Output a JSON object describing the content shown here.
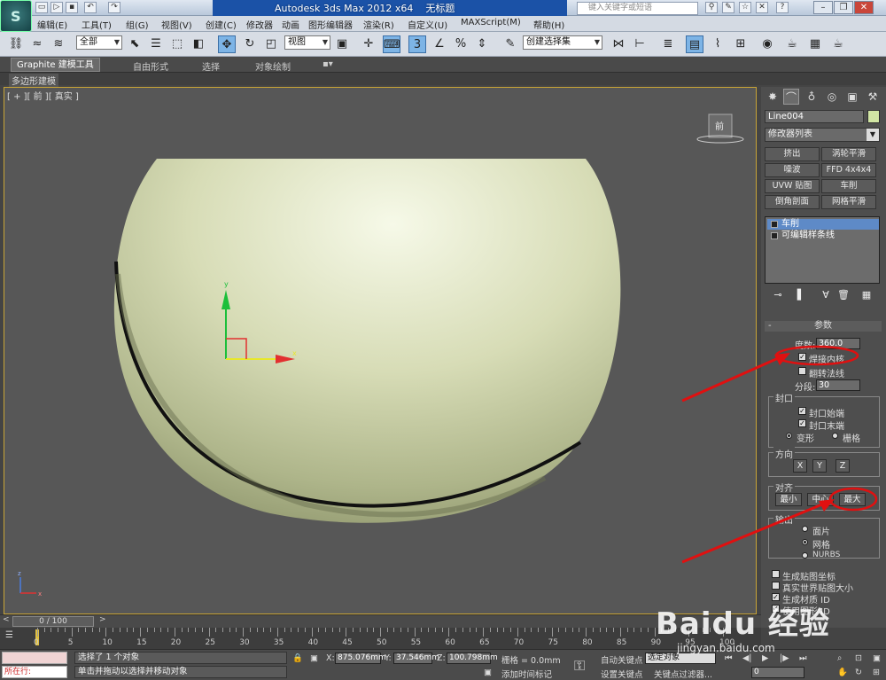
{
  "app": {
    "title": "Autodesk 3ds Max  2012 x64",
    "doc": "无标题",
    "search_placeholder": "键入关键字或短语",
    "logo": "S"
  },
  "menu": [
    "编辑(E)",
    "工具(T)",
    "组(G)",
    "视图(V)",
    "创建(C)",
    "修改器",
    "动画",
    "图形编辑器",
    "渲染(R)",
    "自定义(U)",
    "MAXScript(M)",
    "帮助(H)"
  ],
  "toolbar": {
    "filter": "全部",
    "refcoord": "视图",
    "selset": "创建选择集"
  },
  "ribbon": {
    "tabs": [
      "Graphite 建模工具",
      "自由形式",
      "选择",
      "对象绘制"
    ],
    "sub": "多边形建模"
  },
  "viewport": {
    "label": "[ + ][ 前 ][ 真实 ]",
    "viewcube_face": "前",
    "axis_y": "y",
    "axis_x": "x",
    "mini_axis_z": "z",
    "mini_axis_x": "x"
  },
  "panel": {
    "object_name": "Line004",
    "object_color": "#d2e6a4",
    "modifier_list": "修改器列表",
    "mod_buttons": [
      "挤出",
      "涡轮平滑",
      "噪波",
      "FFD 4x4x4",
      "UVW 贴图",
      "车削",
      "倒角剖面",
      "网格平滑"
    ],
    "stack": [
      "车削",
      "可编辑样条线"
    ],
    "params_title": "参数",
    "degrees_label": "度数:",
    "degrees_value": "360.0",
    "weld_core": "焊接内核",
    "flip_normals": "翻转法线",
    "segments_label": "分段:",
    "segments_value": "30",
    "cap_group": "封口",
    "cap_start": "封口始端",
    "cap_end": "封口末端",
    "morph": "变形",
    "grid": "栅格",
    "direction_group": "方向",
    "dir_buttons": [
      "X",
      "Y",
      "Z"
    ],
    "align_group": "对齐",
    "align_buttons": [
      "最小",
      "中心",
      "最大"
    ],
    "output_group": "输出",
    "output_patch": "面片",
    "output_mesh": "网格",
    "output_nurbs": "NURBS",
    "gen_map": "生成贴图坐标",
    "real_world": "真实世界贴图大小",
    "gen_mat": "生成材质 ID",
    "use_shape": "使用图形 ID"
  },
  "timeline": {
    "frame": "0 / 100",
    "ticks": [
      "0",
      "5",
      "10",
      "15",
      "20",
      "25",
      "30",
      "35",
      "40",
      "45",
      "50",
      "55",
      "60",
      "65",
      "70",
      "75",
      "80",
      "85",
      "90",
      "95",
      "100"
    ]
  },
  "status": {
    "listener": "所在行:",
    "selection": "选择了 1 个对象",
    "prompt": "单击并拖动以选择并移动对象",
    "x_label": "X:",
    "x": "875.076mm",
    "y_label": "Y:",
    "y": "37.546mm",
    "z_label": "Z:",
    "z": "100.798mm",
    "grid": "栅格 = 0.0mm",
    "autokey": "自动关键点",
    "autokey_sel": "选定对象",
    "setkey": "设置关键点",
    "keyfilters": "关键点过滤器...",
    "addtime": "添加时间标记",
    "frame_field": "0"
  },
  "watermark": {
    "brand": "Baidu 经验",
    "url": "jingyan.baidu.com"
  }
}
